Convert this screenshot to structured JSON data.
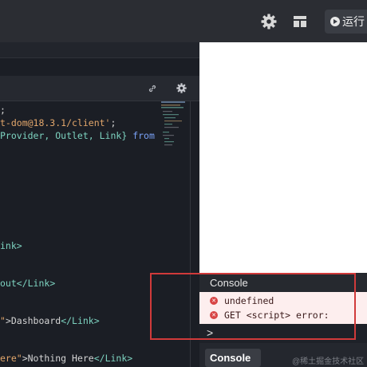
{
  "toolbar": {
    "settings_icon": "gear-icon",
    "layout_icon": "layout-grid-icon",
    "run_label": "运行"
  },
  "editor": {
    "header_icons": [
      "link-icon",
      "gear-icon"
    ],
    "code_lines": {
      "l1": ";",
      "l2a": "t-dom@18.3.1/client'",
      "l2b": ";",
      "l3a": "Provider, Outlet, Link}",
      "l3b": "from",
      "l4": "ink>",
      "l5a": "out",
      "l5b": "</Link>",
      "l6a": "\"",
      "l6b": ">Dashboard",
      "l6c": "</Link>",
      "l7a": "ere\"",
      "l7b": ">Nothing Here",
      "l7c": "</Link>"
    }
  },
  "console": {
    "title": "Console",
    "entries": [
      {
        "text": "undefined",
        "level": "error"
      },
      {
        "text": "GET <script> error:",
        "level": "error"
      }
    ],
    "prompt": ">",
    "tab_label": "Console ⌄"
  },
  "watermark": "@稀土掘金技术社区",
  "colors": {
    "highlight_border": "#d03a3a",
    "error_bg": "#fdeeee",
    "error_icon": "#d84545"
  }
}
